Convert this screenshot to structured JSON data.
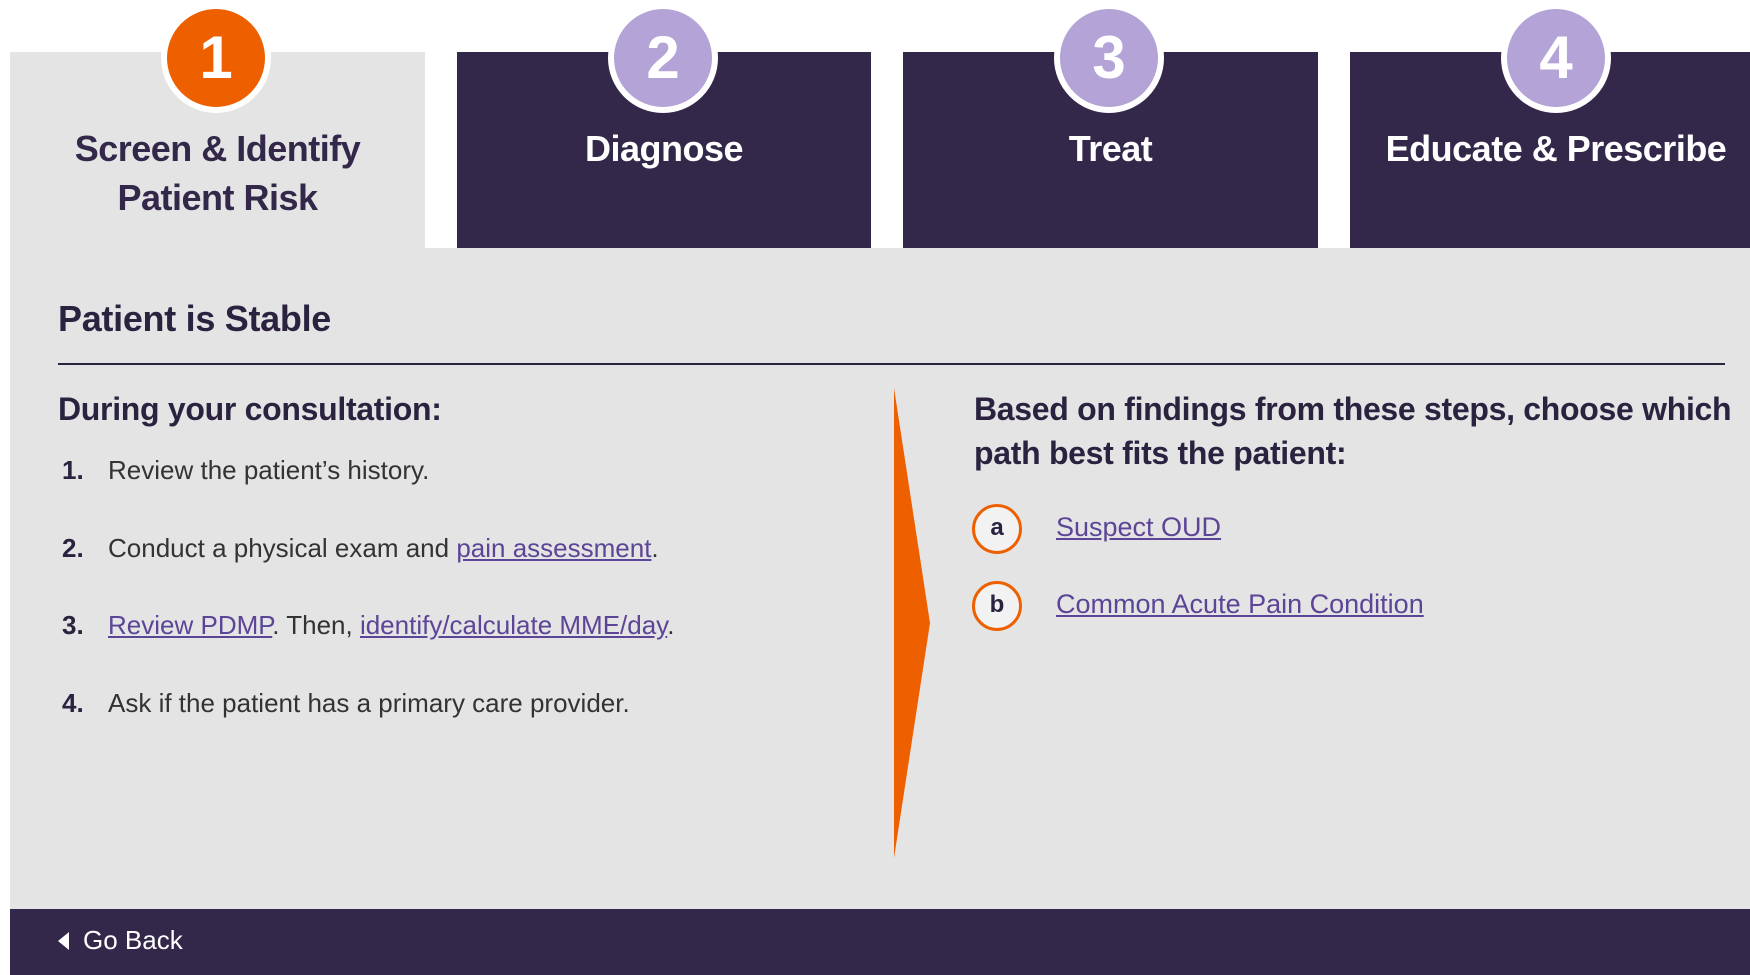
{
  "steps": [
    {
      "number": "1",
      "label": "Screen & Identify\nPatient Risk",
      "active": true
    },
    {
      "number": "2",
      "label": "Diagnose",
      "active": false
    },
    {
      "number": "3",
      "label": "Treat",
      "active": false
    },
    {
      "number": "4",
      "label": "Educate & Prescribe",
      "active": false
    }
  ],
  "panel": {
    "title": "Patient is Stable",
    "left": {
      "heading": "During your consultation:",
      "items": [
        {
          "num": "1.",
          "text": "Review the patient’s history."
        },
        {
          "num": "2.",
          "pre": "Conduct a physical exam and ",
          "link": "pain assessment",
          "post": "."
        },
        {
          "num": "3.",
          "link": "Review PDMP",
          "mid": ". Then, ",
          "link2": "identify/calculate MME/day",
          "post": "."
        },
        {
          "num": "4.",
          "text": "Ask if the patient has a primary care provider."
        }
      ]
    },
    "right": {
      "heading": "Based on findings from these steps, choose which path best fits the patient:",
      "paths": [
        {
          "letter": "a",
          "label": "Suspect OUD"
        },
        {
          "letter": "b",
          "label": "Common Acute Pain Condition"
        }
      ]
    }
  },
  "footer": {
    "go_back": "Go Back"
  },
  "colors": {
    "navy": "#33274a",
    "orange": "#ee5f00",
    "lavender": "#b3a3d6",
    "panel": "#e4e4e4",
    "link": "#5c4596"
  }
}
